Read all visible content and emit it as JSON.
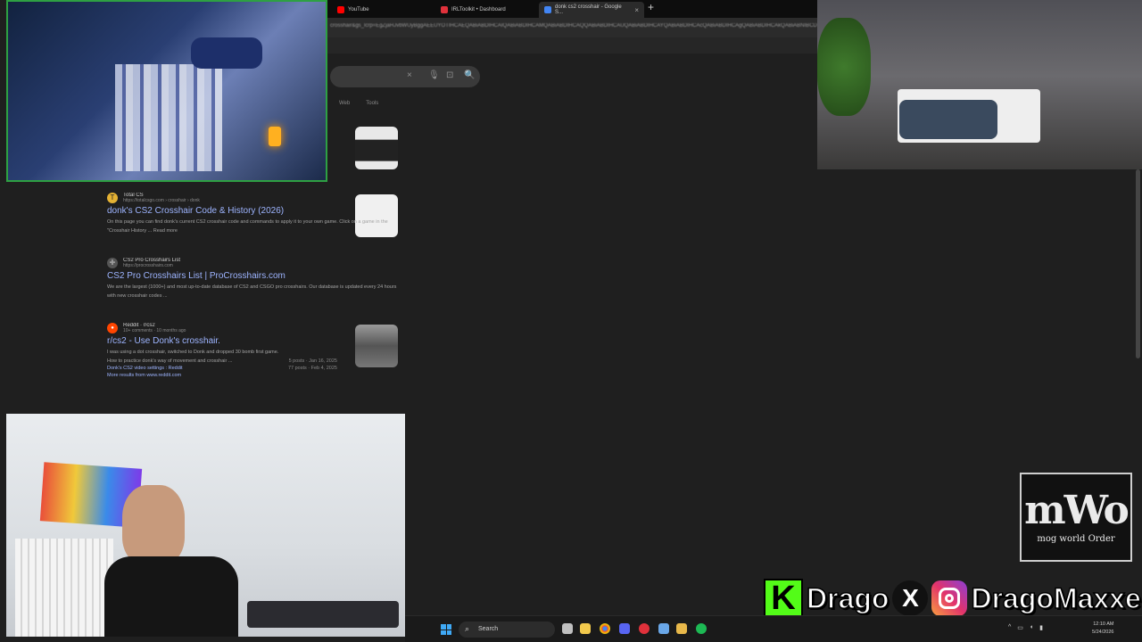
{
  "browser": {
    "tabs": [
      {
        "label": "YouTube",
        "color": "#ff0000",
        "active": false
      },
      {
        "label": "IRLToolkit • Dashboard",
        "color": "#e0313b",
        "active": false
      },
      {
        "label": "donk cs2 crosshair - Google S...",
        "color": "#4285f4",
        "active": true
      }
    ],
    "new_tab": "+",
    "url": "crosshair&gs_lcrp=EgZjaHJvbWUyBggAEEUYOTIHCAEQABiABDIHCAIQABiABDIHCAMQABiABDIHCAQQABiABDIHCAUQABiABDIHCAYQABiABDIHCAcQABiABDIHCAgQABiABDIHCAkQABiABNIBCDY4NjdqMGo3qAIIsAIB8QVVyWjC&sourceid=chrome&ie=UTF-8",
    "search_icons": {
      "clear": "×",
      "mic": "🎙",
      "lens": "⊡",
      "search": "🔍"
    },
    "filters": [
      "Web",
      "Tools"
    ]
  },
  "results": [
    {
      "site_name": "Total CS",
      "url": "https://totalcsgo.com › crosshair › donk",
      "title": "donk's CS2 Crosshair Code & History (2026)",
      "snippet": "On this page you can find donk's current CS2 crosshair code and commands to apply it to your own game. Click on a game in the \"Crosshair History ... Read more",
      "favicon_color": "#e5b234",
      "favicon_glyph": "T"
    },
    {
      "site_name": "CS2 Pro Crosshairs List",
      "url": "https://procrosshairs.com",
      "title": "CS2 Pro Crosshairs List | ProCrosshairs.com",
      "snippet": "We are the largest (1000+) and most up-to-date database of CS2 and CSGO pro crosshairs. Our database is updated every 24 hours with new crosshair codes ...",
      "favicon_color": "#555555",
      "favicon_glyph": "✛"
    },
    {
      "site_name": "Reddit · r/cs2",
      "url": "10+ comments · 10 months ago",
      "title": "r/cs2 - Use Donk's crosshair.",
      "snippet": "I was using a dot crosshair, switched to Donk and dropped 30 bomb first game.",
      "favicon_color": "#ff4500",
      "favicon_glyph": "●",
      "sublinks": [
        {
          "text": "How to practice donk's way of movement and crosshair ...",
          "meta": "5 posts · Jan 16, 2025"
        },
        {
          "text": "Donk's CS2 video settings : Reddit",
          "meta": "77 posts · Feb 4, 2025"
        }
      ],
      "more": "More results from www.reddit.com"
    }
  ],
  "overlay": {
    "logo_main": "mWo",
    "logo_sub": "mog world Order",
    "kick_letter": "K",
    "kick_name": "Drago",
    "x_letter": "X",
    "ig_name": "DragoMaxxer"
  },
  "taskbar": {
    "search_label": "Search",
    "time": "12:10 AM",
    "date": "5/24/2026"
  }
}
